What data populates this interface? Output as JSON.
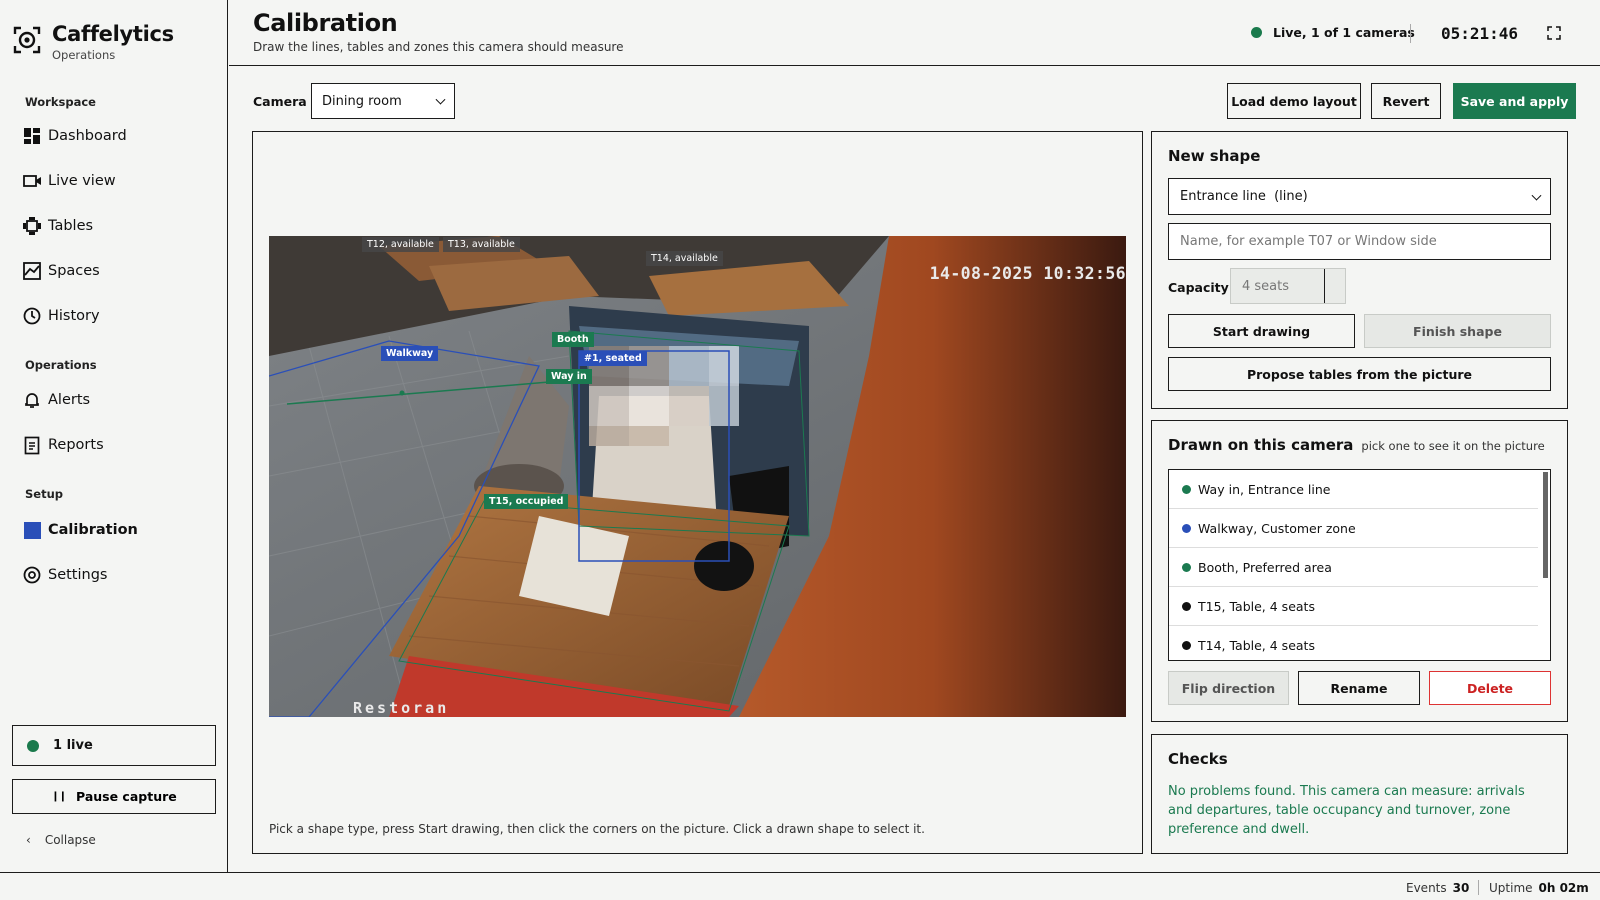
{
  "app": {
    "name": "Caffelytics",
    "subtitle": "Operations"
  },
  "sidebar": {
    "sections": {
      "workspace": "Workspace",
      "operations": "Operations",
      "setup": "Setup"
    },
    "items": [
      {
        "label": "Dashboard",
        "icon": "dashboard-icon"
      },
      {
        "label": "Live view",
        "icon": "video-camera-icon"
      },
      {
        "label": "Tables",
        "icon": "table-icon"
      },
      {
        "label": "Spaces",
        "icon": "chart-icon"
      },
      {
        "label": "History",
        "icon": "clock-icon"
      },
      {
        "label": "Alerts",
        "icon": "bell-icon"
      },
      {
        "label": "Reports",
        "icon": "document-icon"
      },
      {
        "label": "Calibration",
        "icon": "square-icon"
      },
      {
        "label": "Settings",
        "icon": "gear-icon"
      }
    ],
    "active": "Calibration",
    "live_count": "1 live",
    "pause_label": "Pause capture",
    "collapse_label": "Collapse"
  },
  "header": {
    "title": "Calibration",
    "subtitle": "Draw the lines, tables and zones this camera should measure",
    "live_status": "Live, 1 of 1 cameras",
    "clock": "05:21:46"
  },
  "toolbar": {
    "camera_label": "Camera",
    "camera_value": "Dining room",
    "load_demo": "Load demo layout",
    "revert": "Revert",
    "save_apply": "Save and apply"
  },
  "camera_view": {
    "timestamp": "14-08-2025 10:32:56",
    "watermark": "Restoran",
    "labels": {
      "t12": "T12, available",
      "t13": "T13, available",
      "t14": "T14, available",
      "booth": "Booth",
      "walkway": "Walkway",
      "way_in": "Way in",
      "person": "#1, seated",
      "t15": "T15, occupied"
    },
    "hint": "Pick a shape type, press Start drawing, then click the corners on the picture. Click a drawn shape to select it."
  },
  "new_shape": {
    "title": "New shape",
    "type_value": "Entrance line  (line)",
    "name_placeholder": "Name, for example T07 or Window side",
    "capacity_label": "Capacity",
    "capacity_value": "4 seats",
    "start_drawing": "Start drawing",
    "finish_shape": "Finish shape",
    "propose": "Propose tables from the picture"
  },
  "drawn": {
    "title": "Drawn on this camera",
    "hint": "pick one to see it on the picture",
    "items": [
      {
        "label": "Way in, Entrance line",
        "color": "#1b7a50"
      },
      {
        "label": "Walkway, Customer zone",
        "color": "#2a4fb8"
      },
      {
        "label": "Booth, Preferred area",
        "color": "#1b7a50"
      },
      {
        "label": "T15, Table, 4 seats",
        "color": "#111111"
      },
      {
        "label": "T14, Table, 4 seats",
        "color": "#111111"
      }
    ],
    "flip": "Flip direction",
    "rename": "Rename",
    "delete": "Delete"
  },
  "checks": {
    "title": "Checks",
    "text": "No problems found. This camera can measure: arrivals and departures, table occupancy and turnover, zone preference and dwell."
  },
  "footer": {
    "events_label": "Events",
    "events_value": "30",
    "uptime_label": "Uptime",
    "uptime_value": "0h 02m"
  },
  "colors": {
    "accent": "#1b7a50",
    "zone_blue": "#2a4fb8",
    "danger": "#cc2222"
  }
}
